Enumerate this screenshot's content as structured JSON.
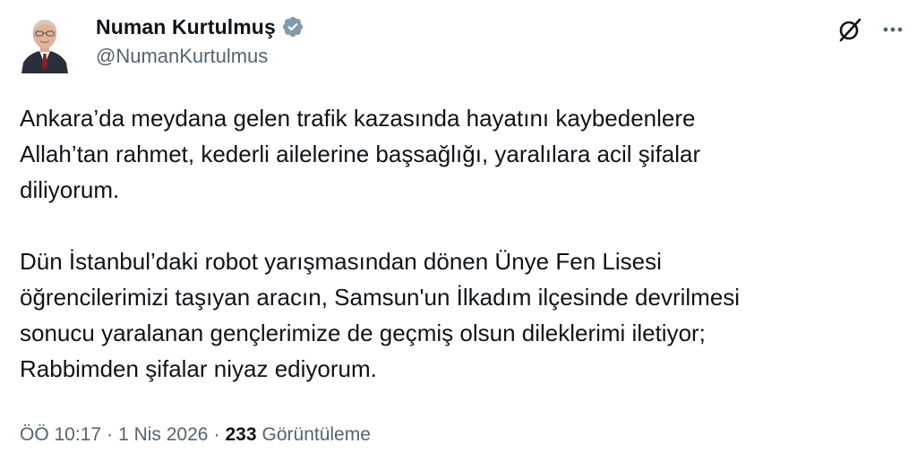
{
  "author": {
    "display_name": "Numan Kurtulmuş",
    "handle": "@NumanKurtulmus",
    "verified": true,
    "verified_color": "#829aab"
  },
  "icons": {
    "grok": "grok-icon",
    "more": "more-icon",
    "verified": "verified-badge-icon"
  },
  "tweet": {
    "text": "Ankara’da meydana gelen trafik kazasında hayatını kaybedenlere\nAllah’tan rahmet, kederli ailelerine başsağlığı, yaralılara acil şifalar\ndiliyorum.\n\nDün İstanbul’daki robot yarışmasından dönen Ünye Fen Lisesi\nöğrencilerimizi taşıyan aracın, Samsun'un İlkadım ilçesinde devrilmesi\nsonucu yaralanan gençlerimize de geçmiş olsun dileklerimi iletiyor;\nRabbimden şifalar niyaz ediyorum."
  },
  "meta": {
    "time": "ÖÖ 10:17",
    "separator": "·",
    "date": "1 Nis 2026",
    "views_count": "233",
    "views_label": "Görüntüleme"
  },
  "colors": {
    "text_primary": "#0f1419",
    "text_secondary": "#536471",
    "background": "#ffffff"
  }
}
